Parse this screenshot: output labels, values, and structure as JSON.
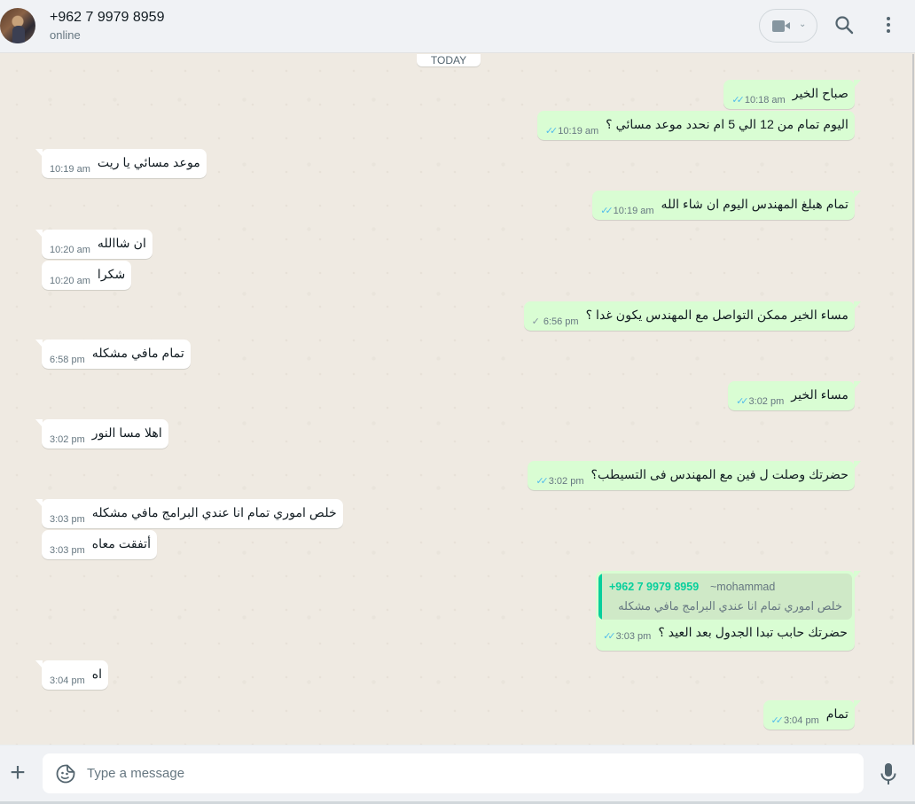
{
  "header": {
    "contact_name": "+962 7 9979 8959",
    "status": "online",
    "video_chevron": "⌄"
  },
  "chat": {
    "date_chip": "TODAY",
    "messages": [
      {
        "dir": "out",
        "text": "صباح الخير",
        "time": "10:18 am",
        "ticks": "✓✓"
      },
      {
        "dir": "out",
        "text": "اليوم تمام من 12 الي 5 ام نحدد موعد مسائي ؟",
        "time": "10:19 am",
        "ticks": "✓✓"
      },
      {
        "dir": "in",
        "text": "موعد مسائي يا ريت",
        "time": "10:19 am"
      },
      {
        "dir": "out",
        "text": "تمام هبلغ المهندس اليوم ان شاء الله",
        "time": "10:19 am",
        "ticks": "✓✓"
      },
      {
        "dir": "in",
        "text": "ان شاالله",
        "time": "10:20 am"
      },
      {
        "dir": "in",
        "text": "شكرا",
        "time": "10:20 am"
      },
      {
        "dir": "out",
        "text": "مساء الخير ممكن التواصل مع المهندس يكون غدا ؟",
        "time": "6:56 pm",
        "ticks": "✓"
      },
      {
        "dir": "in",
        "text": "تمام مافي مشكله",
        "time": "6:58 pm"
      },
      {
        "dir": "out",
        "text": "مساء الخير",
        "time": "3:02 pm",
        "ticks": "✓✓"
      },
      {
        "dir": "in",
        "text": "اهلا مسا النور",
        "time": "3:02 pm"
      },
      {
        "dir": "out",
        "text": "حضرتك وصلت ل فين مع المهندس فى التسيطب؟",
        "time": "3:02 pm",
        "ticks": "✓✓"
      },
      {
        "dir": "in",
        "text": "خلص اموري تمام انا عندي البرامج مافي مشكله",
        "time": "3:03 pm"
      },
      {
        "dir": "in",
        "text": "أتفقت معاه",
        "time": "3:03 pm"
      },
      {
        "dir": "in",
        "text": "اه",
        "time": "3:04 pm"
      },
      {
        "dir": "out",
        "text": "تمام",
        "time": "3:04 pm",
        "ticks": "✓✓"
      }
    ],
    "reply": {
      "quoted_phone": "+962 7 9979 8959",
      "quoted_author": "~mohammad",
      "quoted_text": "خلص اموري تمام انا عندي البرامج مافي مشكله",
      "text": "حضرتك حابب تبدا الجدول بعد العيد ؟",
      "time": "3:03 pm",
      "ticks": "✓✓"
    }
  },
  "composer": {
    "plus_label": "+",
    "placeholder": "Type a message"
  },
  "colors": {
    "outgoing_bubble": "#d9fdd3",
    "incoming_bubble": "#ffffff",
    "read_ticks": "#53bdeb",
    "chat_background": "#efeae2",
    "quote_accent": "#06cf9c"
  },
  "icons": [
    "video-call-icon",
    "search-icon",
    "menu-icon",
    "plus-icon",
    "sticker-icon",
    "mic-icon"
  ]
}
